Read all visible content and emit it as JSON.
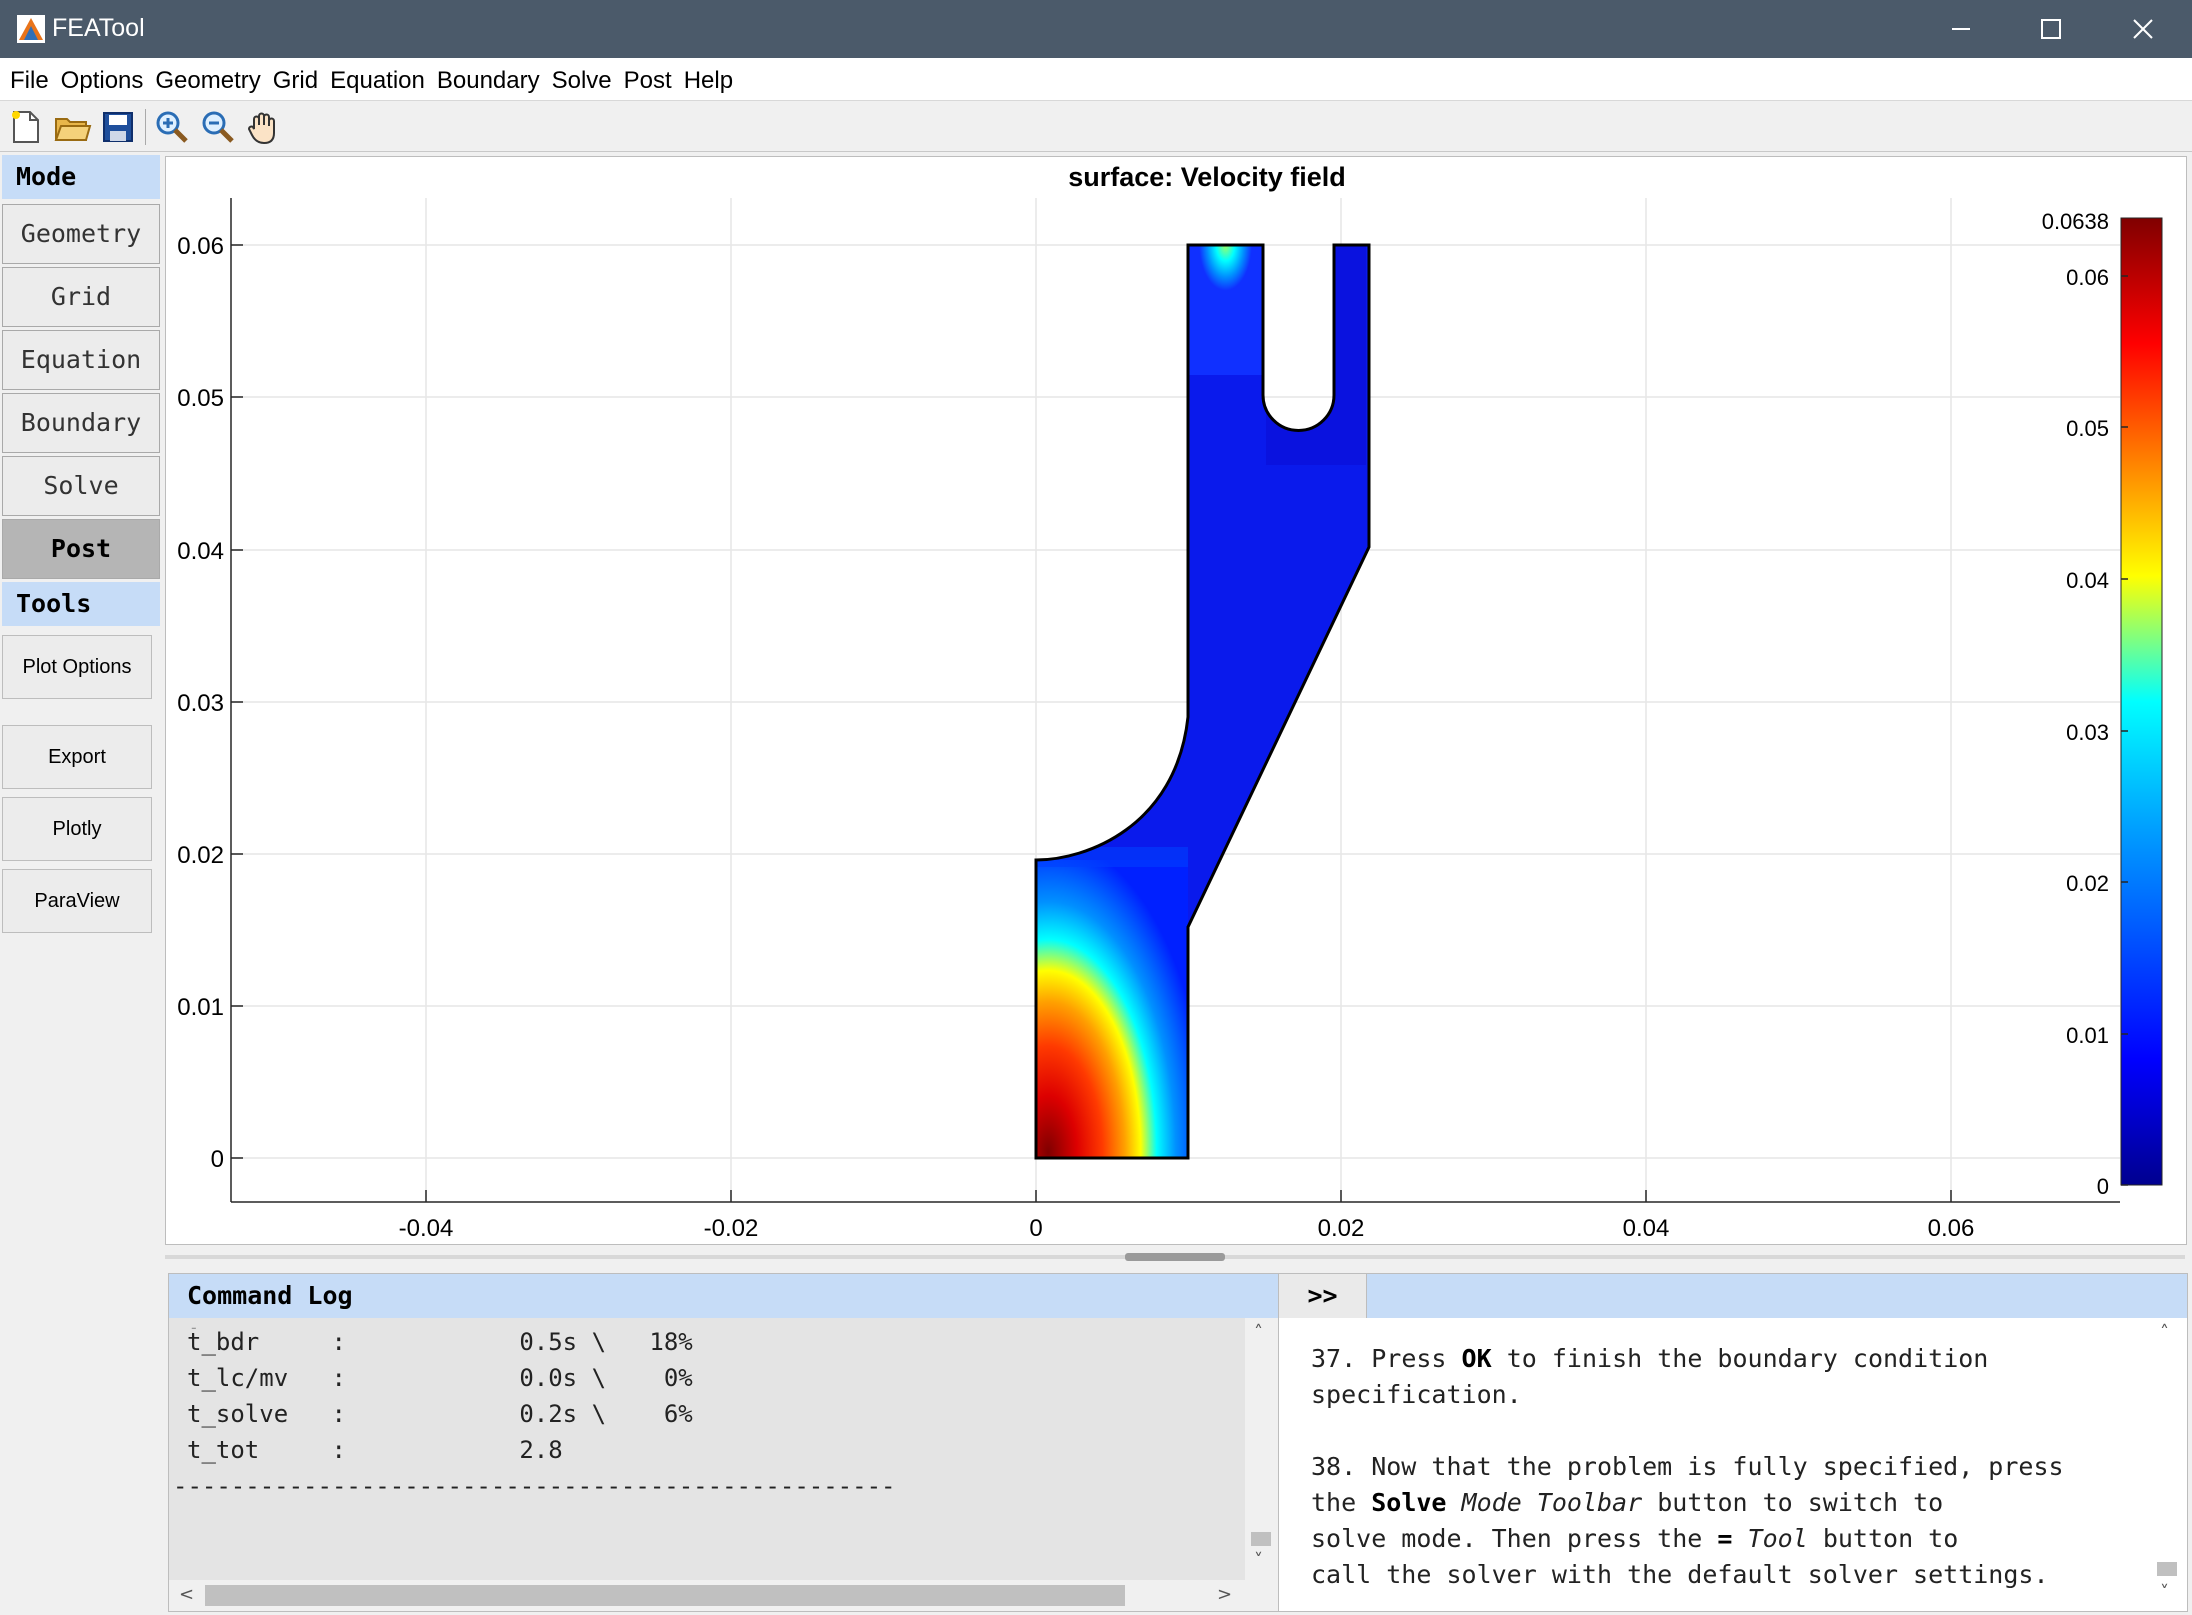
{
  "window": {
    "title": "FEATool"
  },
  "menu": [
    "File",
    "Options",
    "Geometry",
    "Grid",
    "Equation",
    "Boundary",
    "Solve",
    "Post",
    "Help"
  ],
  "toolbar": {
    "icons": [
      "new-file-icon",
      "open-folder-icon",
      "save-icon",
      "zoom-in-icon",
      "zoom-out-icon",
      "pan-hand-icon"
    ]
  },
  "sidebar": {
    "mode_header": "Mode",
    "modes": [
      "Geometry",
      "Grid",
      "Equation",
      "Boundary",
      "Solve",
      "Post"
    ],
    "active_mode": "Post",
    "tools_header": "Tools",
    "tools": [
      "Plot Options",
      "Export",
      "Plotly",
      "ParaView"
    ]
  },
  "plot": {
    "title": "surface: Velocity field",
    "x_ticks": [
      "-0.04",
      "-0.02",
      "0",
      "0.02",
      "0.04",
      "0.06"
    ],
    "y_ticks": [
      "0",
      "0.01",
      "0.02",
      "0.03",
      "0.04",
      "0.05",
      "0.06"
    ],
    "colorbar_max_label": "0.0638",
    "colorbar_ticks": [
      "0",
      "0.01",
      "0.02",
      "0.03",
      "0.04",
      "0.05",
      "0.06"
    ],
    "colormap": "jet",
    "colormap_colors": [
      "#00008f",
      "#0000ff",
      "#00ffff",
      "#ffff00",
      "#ff0000",
      "#800000"
    ]
  },
  "log": {
    "header": "Command Log",
    "lines": [
      "t_bdr     :            0.5s \\   18%",
      "t_lc/mv   :            0.0s \\    0%",
      "t_solve   :            0.2s \\    6%",
      "t_tot     :            2.8",
      "--------------------------------------------------"
    ]
  },
  "help": {
    "toggle_label": ">>",
    "p37": {
      "num": "37.",
      "w1": "Press",
      "b1": "OK",
      "w2": "to finish the boundary condition",
      "l2": "specification."
    },
    "p38": {
      "l1": "38. Now that the problem is fully specified, press",
      "the": "the",
      "b1": "Solve",
      "i1": "Mode Toolbar",
      "w1": "button to switch to",
      "l3": "solve mode. Then press the",
      "b2": "=",
      "i2": "Tool",
      "w2": "button to",
      "l4": "call the solver with the default solver settings."
    }
  }
}
